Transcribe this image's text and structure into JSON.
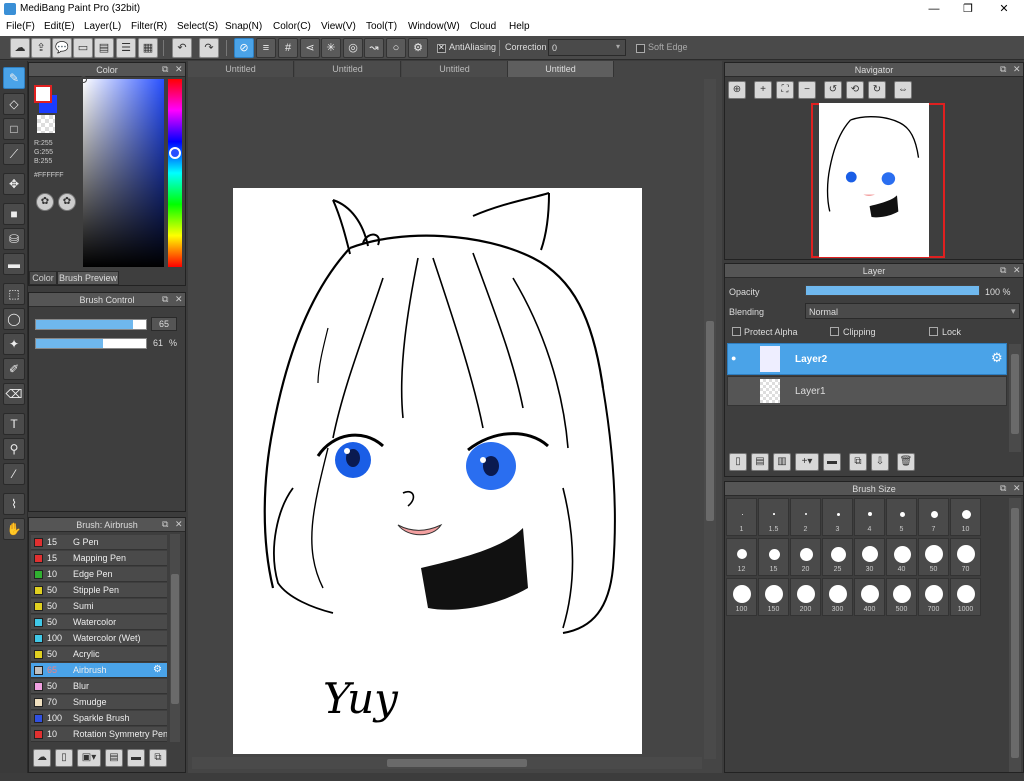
{
  "window": {
    "title": "MediBang Paint Pro (32bit)",
    "minimize": "—",
    "restore": "❐",
    "close": "✕"
  },
  "menu": [
    "File(F)",
    "Edit(E)",
    "Layer(L)",
    "Filter(R)",
    "Select(S)",
    "Snap(N)",
    "Color(C)",
    "View(V)",
    "Tool(T)",
    "Window(W)",
    "Cloud",
    "Help"
  ],
  "toolbar": {
    "antialiasing_label": "AntiAliasing",
    "correction_label": "Correction",
    "correction_value": "0",
    "soft_edge_label": "Soft Edge"
  },
  "color_panel": {
    "title": "Color",
    "rgb": {
      "r": "R:255",
      "g": "G:255",
      "b": "B:255"
    },
    "hex": "#FFFFFF",
    "tabs": [
      "Color",
      "Brush Preview"
    ]
  },
  "brush_control": {
    "title": "Brush Control",
    "size_value": "65",
    "size_fraction": 0.88,
    "opacity_value": "61",
    "opacity_unit": "%",
    "opacity_fraction": 0.61
  },
  "brush_list": {
    "title": "Brush: Airbrush",
    "items": [
      {
        "size": "15",
        "name": "G Pen",
        "color": "#e03030"
      },
      {
        "size": "15",
        "name": "Mapping Pen",
        "color": "#e03030"
      },
      {
        "size": "10",
        "name": "Edge Pen",
        "color": "#30b030"
      },
      {
        "size": "50",
        "name": "Stipple Pen",
        "color": "#e0d020"
      },
      {
        "size": "50",
        "name": "Sumi",
        "color": "#e0d020"
      },
      {
        "size": "50",
        "name": "Watercolor",
        "color": "#40c8e8"
      },
      {
        "size": "100",
        "name": "Watercolor (Wet)",
        "color": "#40c8e8"
      },
      {
        "size": "50",
        "name": "Acrylic",
        "color": "#e0d020"
      },
      {
        "size": "65",
        "name": "Airbrush",
        "color": "#c0c0c0"
      },
      {
        "size": "50",
        "name": "Blur",
        "color": "#f0a0e0"
      },
      {
        "size": "70",
        "name": "Smudge",
        "color": "#f0e0c0"
      },
      {
        "size": "100",
        "name": "Sparkle Brush",
        "color": "#3050e0"
      },
      {
        "size": "10",
        "name": "Rotation Symmetry Pen",
        "color": "#e03030"
      }
    ],
    "selected_index": 8
  },
  "doc_tabs": [
    "Untitled",
    "Untitled",
    "Untitled",
    "Untitled"
  ],
  "navigator": {
    "title": "Navigator"
  },
  "layer_panel": {
    "title": "Layer",
    "opacity_label": "Opacity",
    "opacity_value": "100 %",
    "blending_label": "Blending",
    "blending_value": "Normal",
    "protect_alpha": "Protect Alpha",
    "clipping": "Clipping",
    "lock": "Lock",
    "layers": [
      {
        "name": "Layer2",
        "selected": true
      },
      {
        "name": "Layer1",
        "selected": false
      }
    ]
  },
  "brush_size": {
    "title": "Brush Size",
    "sizes": [
      "1",
      "1.5",
      "2",
      "3",
      "4",
      "5",
      "7",
      "10",
      "12",
      "15",
      "20",
      "25",
      "30",
      "40",
      "50",
      "70",
      "100",
      "150",
      "200",
      "300",
      "400",
      "500",
      "700",
      "1000"
    ]
  },
  "signature_text": "Yuy"
}
